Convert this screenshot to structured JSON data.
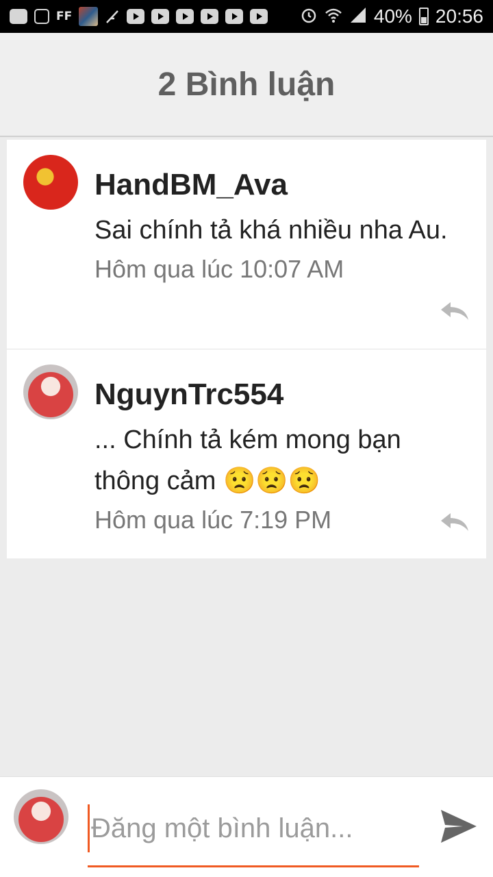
{
  "status_bar": {
    "ff": "FF",
    "battery": "40%",
    "time": "20:56"
  },
  "header": {
    "title": "2 Bình luận"
  },
  "comments": [
    {
      "author": "HandBM_Ava",
      "text": "Sai chính tả khá nhiều nha Au.",
      "time": "Hôm qua lúc 10:07 AM"
    },
    {
      "author": "NguynTrc554",
      "text": "... Chính tả kém mong bạn thông cảm 😟😟😟",
      "time": "Hôm qua lúc 7:19 PM"
    }
  ],
  "composer": {
    "placeholder": "Đăng một bình luận...",
    "value": ""
  },
  "colors": {
    "accent": "#f05a22",
    "header_text": "#5f5f5f",
    "timestamp": "#777777",
    "background": "#ececec"
  }
}
